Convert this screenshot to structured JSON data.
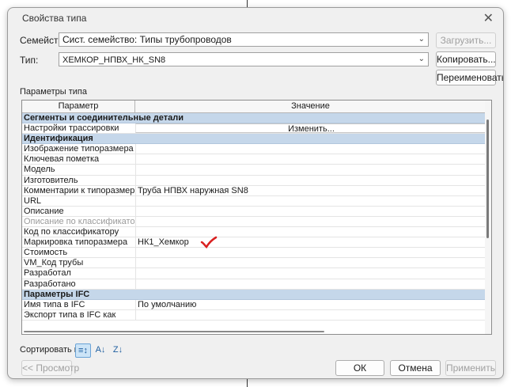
{
  "dialog": {
    "title": "Свойства типа",
    "close_glyph": "✕"
  },
  "family": {
    "label": "Семейство:",
    "value": "Сист. семейство: Типы трубопроводов",
    "load_button": "Загрузить..."
  },
  "type": {
    "label": "Тип:",
    "value": "ХЕМКОР_НПВХ_НК_SN8",
    "copy_button": "Копировать...",
    "rename_button": "Переименовать..."
  },
  "params_section_label": "Параметры типа",
  "grid": {
    "headers": {
      "param": "Параметр",
      "value": "Значение"
    },
    "rows": [
      {
        "kind": "group",
        "param": "Сегменты и соединительные детали",
        "value": ""
      },
      {
        "kind": "button",
        "param": "Настройки трассировки",
        "value": "Изменить..."
      },
      {
        "kind": "group",
        "param": "Идентификация",
        "value": ""
      },
      {
        "kind": "row",
        "param": "Изображение типоразмера",
        "value": ""
      },
      {
        "kind": "row",
        "param": "Ключевая пометка",
        "value": ""
      },
      {
        "kind": "row",
        "param": "Модель",
        "value": ""
      },
      {
        "kind": "row",
        "param": "Изготовитель",
        "value": ""
      },
      {
        "kind": "row",
        "param": "Комментарии к типоразмеру",
        "value": "Труба НПВХ наружная SN8"
      },
      {
        "kind": "row",
        "param": "URL",
        "value": ""
      },
      {
        "kind": "row",
        "param": "Описание",
        "value": ""
      },
      {
        "kind": "dim",
        "param": "Описание по классификатору",
        "value": ""
      },
      {
        "kind": "row",
        "param": "Код по классификатору",
        "value": ""
      },
      {
        "kind": "row",
        "param": "Маркировка типоразмера",
        "value": "НК1_Хемкор",
        "mark": true
      },
      {
        "kind": "row",
        "param": "Стоимость",
        "value": ""
      },
      {
        "kind": "row",
        "param": "VM_Код трубы",
        "value": ""
      },
      {
        "kind": "row",
        "param": "Разработал",
        "value": ""
      },
      {
        "kind": "row",
        "param": "Разработано",
        "value": ""
      },
      {
        "kind": "group",
        "param": "Параметры IFC",
        "value": ""
      },
      {
        "kind": "row",
        "param": "Имя типа в IFC",
        "value": "По умолчанию"
      },
      {
        "kind": "row",
        "param": "Экспорт типа в IFC как",
        "value": ""
      }
    ],
    "check_mark_color": "#d92020",
    "group_color": "#c5d7ea"
  },
  "sort": {
    "label": "Сортировать по:",
    "buttons": [
      {
        "name": "sort-by-group-icon",
        "glyph": "≡↕",
        "active": true
      },
      {
        "name": "sort-ascending-icon",
        "glyph": "A↓",
        "active": false
      },
      {
        "name": "sort-descending-icon",
        "glyph": "Z↓",
        "active": false
      }
    ]
  },
  "footer": {
    "preview_button": "<< Просмотр",
    "ok_button": "ОК",
    "cancel_button": "Отмена",
    "apply_button": "Применить"
  }
}
